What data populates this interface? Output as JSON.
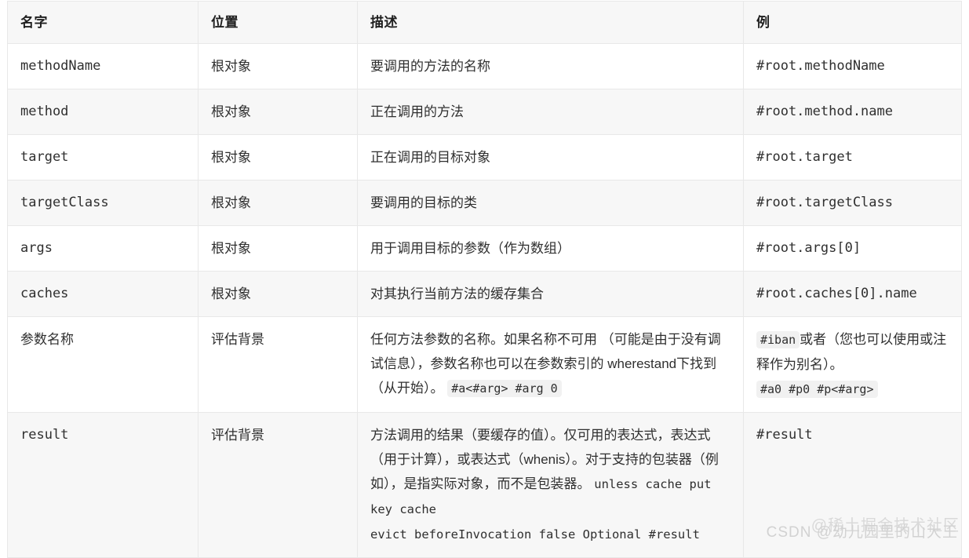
{
  "table": {
    "headers": [
      "名字",
      "位置",
      "描述",
      "例"
    ],
    "rows": [
      {
        "name": "methodName",
        "location": "根对象",
        "description": "要调用的方法的名称",
        "example": "#root.methodName"
      },
      {
        "name": "method",
        "location": "根对象",
        "description": "正在调用的方法",
        "example": "#root.method.name"
      },
      {
        "name": "target",
        "location": "根对象",
        "description": "正在调用的目标对象",
        "example": "#root.target"
      },
      {
        "name": "targetClass",
        "location": "根对象",
        "description": "要调用的目标的类",
        "example": "#root.targetClass"
      },
      {
        "name": "args",
        "location": "根对象",
        "description": "用于调用目标的参数（作为数组）",
        "example": "#root.args[0]"
      },
      {
        "name": "caches",
        "location": "根对象",
        "description": "对其执行当前方法的缓存集合",
        "example": "#root.caches[0].name"
      },
      {
        "name": "参数名称",
        "location": "评估背景",
        "description_text": "任何方法参数的名称。如果名称不可用 （可能是由于没有调试信息），参数名称也可以在参数索引的 wherestand下找到（从开始）。",
        "description_code": "#a<#arg> #arg 0",
        "example_code_1": "#iban",
        "example_text": "或者（您也可以使用或注释作为别名）。",
        "example_code_2": "#a0 #p0 #p<#arg>"
      },
      {
        "name": "result",
        "location": "评估背景",
        "description_text": "方法调用的结果（要缓存的值）。仅可用的表达式，表达式（用于计算），或表达式（whenis）。对于支持的包装器（例如），是指实际对象，而不是包装器。",
        "description_mono_1": "unless cache put key cache",
        "description_mono_2": "evict beforeInvocation false Optional #result",
        "example": "#result"
      }
    ]
  },
  "watermarks": {
    "juejin": "@稀土掘金技术社区",
    "csdn": "CSDN @幼儿园里的山大王"
  }
}
